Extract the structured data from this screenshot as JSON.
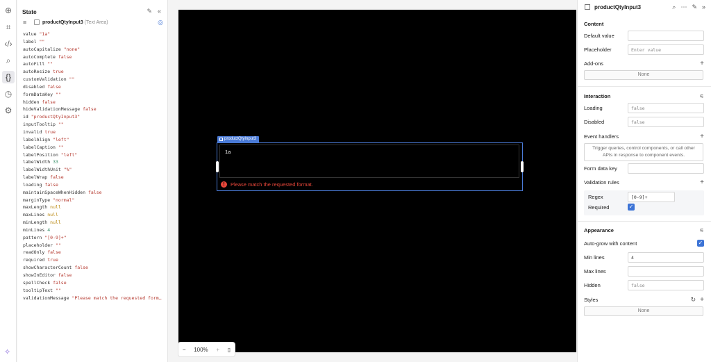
{
  "state_panel": {
    "title": "State",
    "component_name": "productQtyInput3",
    "component_type": "(Text Area)",
    "props": [
      {
        "k": "value",
        "v": "\"1a\"",
        "t": "str"
      },
      {
        "k": "label",
        "v": "\"\"",
        "t": "str"
      },
      {
        "k": "autoCapitalize",
        "v": "\"none\"",
        "t": "str"
      },
      {
        "k": "autoComplete",
        "v": "false",
        "t": "bool"
      },
      {
        "k": "autoFill",
        "v": "\"\"",
        "t": "str"
      },
      {
        "k": "autoResize",
        "v": "true",
        "t": "bool"
      },
      {
        "k": "customValidation",
        "v": "\"\"",
        "t": "str"
      },
      {
        "k": "disabled",
        "v": "false",
        "t": "bool"
      },
      {
        "k": "formDataKey",
        "v": "\"\"",
        "t": "str"
      },
      {
        "k": "hidden",
        "v": "false",
        "t": "bool"
      },
      {
        "k": "hideValidationMessage",
        "v": "false",
        "t": "bool"
      },
      {
        "k": "id",
        "v": "\"productQtyInput3\"",
        "t": "str"
      },
      {
        "k": "inputTooltip",
        "v": "\"\"",
        "t": "str"
      },
      {
        "k": "invalid",
        "v": "true",
        "t": "bool"
      },
      {
        "k": "labelAlign",
        "v": "\"left\"",
        "t": "str"
      },
      {
        "k": "labelCaption",
        "v": "\"\"",
        "t": "str"
      },
      {
        "k": "labelPosition",
        "v": "\"left\"",
        "t": "str"
      },
      {
        "k": "labelWidth",
        "v": "33",
        "t": "num"
      },
      {
        "k": "labelWidthUnit",
        "v": "\"%\"",
        "t": "str"
      },
      {
        "k": "labelWrap",
        "v": "false",
        "t": "bool"
      },
      {
        "k": "loading",
        "v": "false",
        "t": "bool"
      },
      {
        "k": "maintainSpaceWhenHidden",
        "v": "false",
        "t": "bool"
      },
      {
        "k": "marginType",
        "v": "\"normal\"",
        "t": "str"
      },
      {
        "k": "maxLength",
        "v": "null",
        "t": "null"
      },
      {
        "k": "maxLines",
        "v": "null",
        "t": "null"
      },
      {
        "k": "minLength",
        "v": "null",
        "t": "null"
      },
      {
        "k": "minLines",
        "v": "4",
        "t": "num"
      },
      {
        "k": "pattern",
        "v": "\"[0-9]+\"",
        "t": "str"
      },
      {
        "k": "placeholder",
        "v": "\"\"",
        "t": "str"
      },
      {
        "k": "readOnly",
        "v": "false",
        "t": "bool"
      },
      {
        "k": "required",
        "v": "true",
        "t": "bool"
      },
      {
        "k": "showCharacterCount",
        "v": "false",
        "t": "bool"
      },
      {
        "k": "showInEditor",
        "v": "false",
        "t": "bool"
      },
      {
        "k": "spellCheck",
        "v": "false",
        "t": "bool"
      },
      {
        "k": "tooltipText",
        "v": "\"\"",
        "t": "str"
      },
      {
        "k": "validationMessage",
        "v": "\"Please match the requested form…",
        "t": "str"
      }
    ]
  },
  "canvas": {
    "component_label": "productQtyInput3",
    "textarea_value": "1a",
    "error_message": "Please match the requested format.",
    "zoom_level": "100%"
  },
  "inspector": {
    "component_name": "productQtyInput3",
    "content": {
      "title": "Content",
      "default_value_label": "Default value",
      "default_value": "",
      "placeholder_label": "Placeholder",
      "placeholder_value": "Enter value",
      "addons_label": "Add-ons",
      "addons_value": "None"
    },
    "interaction": {
      "title": "Interaction",
      "loading_label": "Loading",
      "loading_value": "false",
      "disabled_label": "Disabled",
      "disabled_value": "false",
      "event_handlers_label": "Event handlers",
      "event_handlers_hint": "Trigger queries, control components, or call other APIs in response to component events.",
      "form_data_key_label": "Form data key",
      "form_data_key_value": "",
      "validation_rules_label": "Validation rules",
      "regex_label": "Regex",
      "regex_value": "[0-9]+",
      "required_label": "Required",
      "required_checked": true
    },
    "appearance": {
      "title": "Appearance",
      "auto_grow_label": "Auto-grow with content",
      "auto_grow_checked": true,
      "min_lines_label": "Min lines",
      "min_lines_value": "4",
      "max_lines_label": "Max lines",
      "max_lines_value": "",
      "hidden_label": "Hidden",
      "hidden_value": "false",
      "styles_label": "Styles",
      "styles_value": "None"
    }
  },
  "colors": {
    "accent": "#4a7ad6",
    "error": "#e8473a",
    "canvas_bg": "#000000"
  }
}
